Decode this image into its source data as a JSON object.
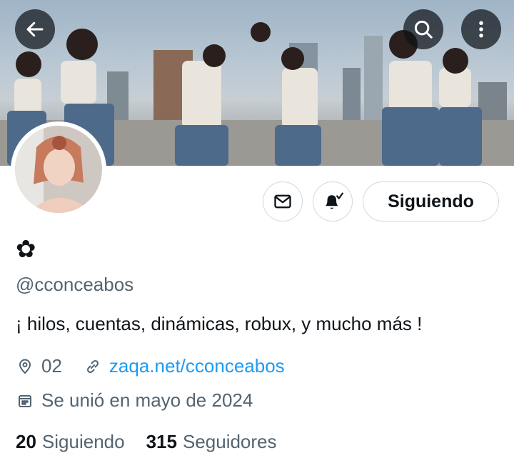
{
  "header": {
    "back_icon": "arrow-left-icon",
    "search_icon": "search-icon",
    "more_icon": "more-vertical-icon"
  },
  "profile": {
    "display_name": "✿",
    "handle": "@cconceabos",
    "bio": "¡ hilos, cuentas, dinámicas, robux, y mucho más !",
    "location": "02",
    "website": "zaqa.net/cconceabos",
    "joined": "Se unió en mayo de 2024"
  },
  "actions": {
    "message_icon": "envelope-icon",
    "notify_icon": "bell-check-icon",
    "follow_label": "Siguiendo"
  },
  "stats": {
    "following_count": "20",
    "following_label": "Siguiendo",
    "followers_count": "315",
    "followers_label": "Seguidores"
  },
  "colors": {
    "text_primary": "#0f1419",
    "text_secondary": "#536471",
    "link": "#1d9bf0",
    "border": "#cfd9de"
  }
}
